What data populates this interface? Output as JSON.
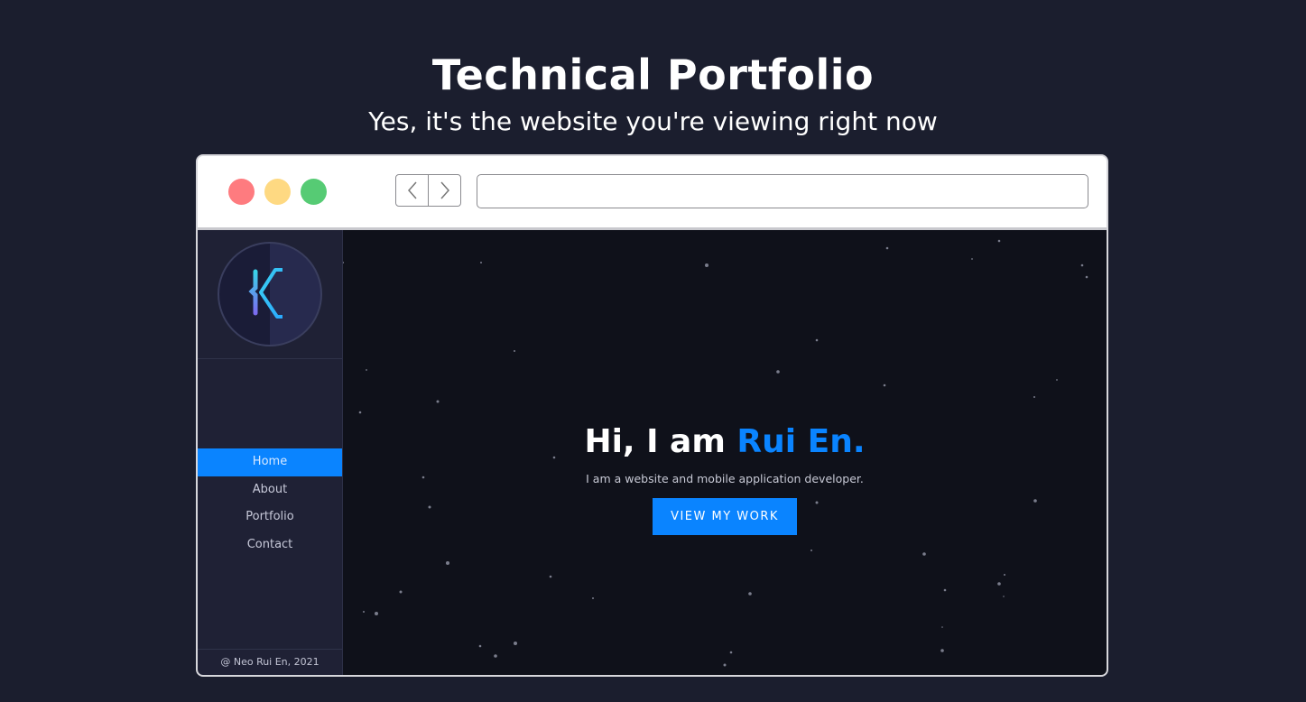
{
  "page": {
    "title": "Technical Portfolio",
    "subtitle": "Yes, it's the website you're viewing right now"
  },
  "browser": {
    "url_value": "",
    "back_icon": "chevron-left-icon",
    "forward_icon": "chevron-right-icon"
  },
  "sidebar": {
    "logo_icon": "k-monogram-logo",
    "items": [
      {
        "label": "Home",
        "active": true
      },
      {
        "label": "About",
        "active": false
      },
      {
        "label": "Portfolio",
        "active": false
      },
      {
        "label": "Contact",
        "active": false
      }
    ],
    "footer": "@ Neo Rui En, 2021"
  },
  "hero": {
    "greeting": "Hi, I am ",
    "name": "Rui En.",
    "tagline": "I am a website and mobile application developer.",
    "cta_label": "VIEW MY WORK"
  },
  "colors": {
    "accent": "#0a84ff",
    "page_bg": "#1b1e2e",
    "hero_bg": "#0f111a",
    "sidebar_bg": "#1f2135",
    "dot_red": "#fe7b7f",
    "dot_yellow": "#fed982",
    "dot_green": "#56cb74"
  }
}
